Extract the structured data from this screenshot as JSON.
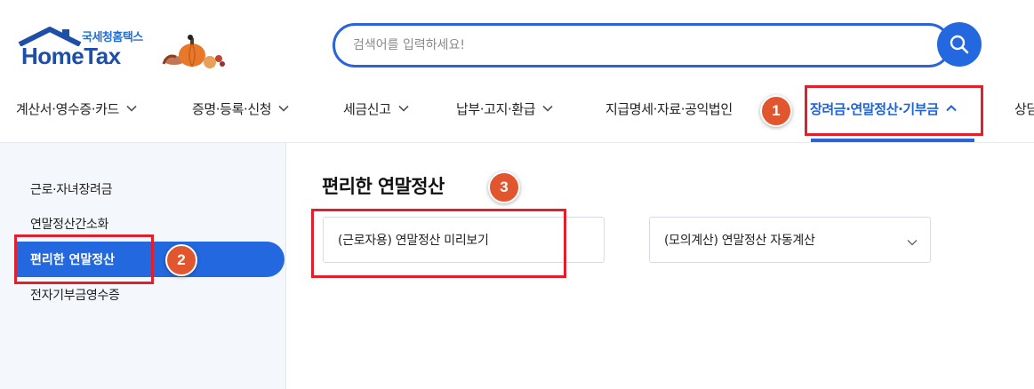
{
  "logo": {
    "subtitle": "국세청홈택스",
    "name": "HomeTax"
  },
  "search": {
    "placeholder": "검색어를 입력하세요!"
  },
  "gnb": {
    "items": [
      {
        "label": "계산서·영수증·카드"
      },
      {
        "label": "증명·등록·신청"
      },
      {
        "label": "세금신고"
      },
      {
        "label": "납부·고지·환급"
      },
      {
        "label": "지급명세·자료·공익법인"
      },
      {
        "label": "장려금·연말정산·기부금"
      },
      {
        "label": "상담"
      }
    ]
  },
  "lnb": {
    "items": [
      {
        "label": "근로·자녀장려금"
      },
      {
        "label": "연말정산간소화"
      },
      {
        "label": "편리한 연말정산"
      },
      {
        "label": "전자기부금영수증"
      }
    ]
  },
  "main": {
    "title": "편리한 연말정산",
    "select_preview": "(근로자용) 연말정산 미리보기",
    "select_calc": "(모의계산) 연말정산 자동계산"
  },
  "annotations": {
    "badge_1": "1",
    "badge_2": "2",
    "badge_3": "3"
  },
  "colors": {
    "accent": "#2468e0",
    "annotation_red": "#e0202d",
    "badge_orange": "#e2562f"
  }
}
